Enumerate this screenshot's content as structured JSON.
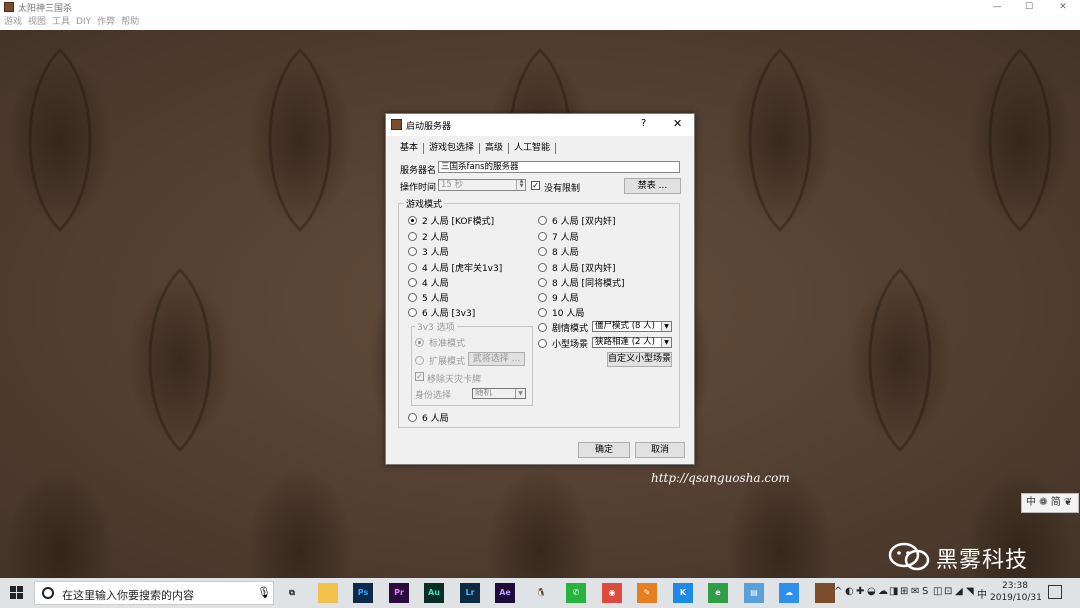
{
  "window": {
    "title": "太阳神三国杀",
    "controls": {
      "minimize": "—",
      "maximize": "☐",
      "close": "✕"
    }
  },
  "menu": [
    "游戏",
    "视图",
    "工具",
    "DIY",
    "作弊",
    "帮助"
  ],
  "dialog": {
    "title": "启动服务器",
    "help": "?",
    "close": "✕",
    "tabs": [
      "基本",
      "游戏包选择",
      "高级",
      "人工智能"
    ],
    "server_name_label": "服务器名",
    "server_name_value": "三国杀fans的服务器",
    "timeout_label": "操作时间",
    "timeout_value": "15 秒",
    "no_limit_label": "没有限制",
    "no_limit_checked": "✓",
    "ban_button": "禁表 ...",
    "game_mode_title": "游戏模式",
    "modes_left": [
      {
        "label": "2 人局 [KOF模式]",
        "selected": true
      },
      {
        "label": "2 人局",
        "selected": false
      },
      {
        "label": "3 人局",
        "selected": false
      },
      {
        "label": "4 人局 [虎牢关1v3]",
        "selected": false
      },
      {
        "label": "4 人局",
        "selected": false
      },
      {
        "label": "5 人局",
        "selected": false
      },
      {
        "label": "6 人局 [3v3]",
        "selected": false
      }
    ],
    "modes_right": [
      {
        "label": "6 人局 [双内奸]",
        "selected": false
      },
      {
        "label": "7 人局",
        "selected": false
      },
      {
        "label": "8 人局",
        "selected": false
      },
      {
        "label": "8 人局 [双内奸]",
        "selected": false
      },
      {
        "label": "8 人局 [同将模式]",
        "selected": false
      },
      {
        "label": "9 人局",
        "selected": false
      },
      {
        "label": "10 人局",
        "selected": false
      }
    ],
    "scenario_label": "剧情模式",
    "scenario_value": "僵尸模式 (8 人)",
    "mini_scene_label": "小型场景",
    "mini_scene_value": "狭路相逢 (2 人)",
    "custom_scene_button": "自定义小型场景",
    "v3_group_title": "3v3 选项",
    "v3_standard": "标准模式",
    "v3_extended": "扩展模式",
    "v3_general_select_button": "武将选择 ...",
    "v3_remove_card": "移除天灾卡牌",
    "v3_remove_checked": "✓",
    "v3_role_label": "身份选择",
    "v3_role_value": "随机",
    "mode_six": "6 人局",
    "ok_button": "确定",
    "cancel_button": "取消"
  },
  "watermark": {
    "url": "http://qsanguosha.com",
    "brand": "黑雾科技"
  },
  "ime": {
    "text": "中 ❁ 简 ❦"
  },
  "taskbar": {
    "search_placeholder": "在这里输入你要搜索的内容",
    "apps": [
      {
        "icon": "task-view-icon",
        "label": "⧉",
        "bg": "transparent",
        "fg": "#222"
      },
      {
        "icon": "file-explorer-icon",
        "label": "",
        "bg": "#f2c14e",
        "fg": "#fff"
      },
      {
        "icon": "photoshop-icon",
        "label": "Ps",
        "bg": "#0d2a4a",
        "fg": "#31a8ff"
      },
      {
        "icon": "premiere-icon",
        "label": "Pr",
        "bg": "#2a0b3d",
        "fg": "#e77cff"
      },
      {
        "icon": "audition-icon",
        "label": "Au",
        "bg": "#0b2d2a",
        "fg": "#38e3b3"
      },
      {
        "icon": "lightroom-icon",
        "label": "Lr",
        "bg": "#0d2a3f",
        "fg": "#49b8ff"
      },
      {
        "icon": "after-effects-icon",
        "label": "Ae",
        "bg": "#1e0b3a",
        "fg": "#c49bff"
      },
      {
        "icon": "qq-icon",
        "label": "🐧",
        "bg": "transparent",
        "fg": "#000"
      },
      {
        "icon": "wechat-icon",
        "label": "✆",
        "bg": "#27b33c",
        "fg": "#fff"
      },
      {
        "icon": "chrome-icon",
        "label": "◉",
        "bg": "#dd4b3e",
        "fg": "#fff"
      },
      {
        "icon": "paint-icon",
        "label": "✎",
        "bg": "#e67e22",
        "fg": "#fff"
      },
      {
        "icon": "k-app-icon",
        "label": "K",
        "bg": "#1d8ae5",
        "fg": "#fff"
      },
      {
        "icon": "browser-icon",
        "label": "e",
        "bg": "#2f9e44",
        "fg": "#fff"
      },
      {
        "icon": "notepad-icon",
        "label": "▤",
        "bg": "#5aa0d8",
        "fg": "#fff"
      },
      {
        "icon": "cloud-icon",
        "label": "☁",
        "bg": "#2d8ff0",
        "fg": "#fff"
      },
      {
        "icon": "sanguosha-icon",
        "label": "",
        "bg": "#7a4e2a",
        "fg": "#fff"
      }
    ],
    "tray_icons": [
      "^",
      "◐",
      "✚",
      "◒",
      "☁",
      "◨",
      "⊞",
      "✉",
      "S",
      "◫",
      "⊡",
      "◢",
      "◥",
      "中"
    ],
    "time": "23:38",
    "date": "2019/10/31"
  }
}
